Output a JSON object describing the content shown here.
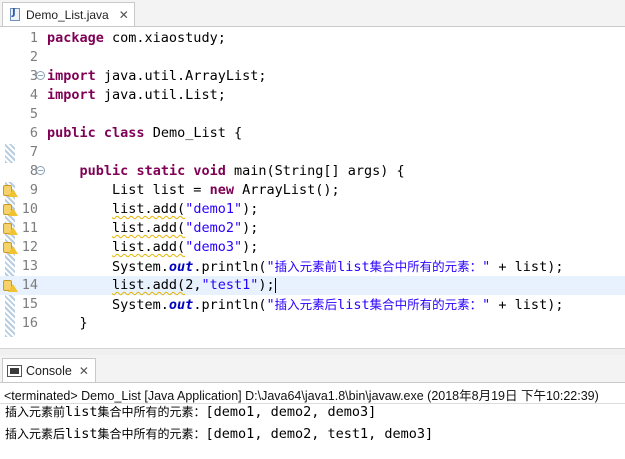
{
  "editor": {
    "tab": {
      "filename": "Demo_List.java",
      "close": "✕"
    },
    "lines": [
      {
        "n": "1",
        "tokens": [
          [
            "kw",
            "package"
          ],
          [
            "",
            "&nbsp;com.xiaostudy;"
          ]
        ]
      },
      {
        "n": "2",
        "tokens": []
      },
      {
        "n": "3",
        "fold": "−",
        "tokens": [
          [
            "kw",
            "import"
          ],
          [
            "",
            "&nbsp;java.util.ArrayList;"
          ]
        ]
      },
      {
        "n": "4",
        "tokens": [
          [
            "kw",
            "import"
          ],
          [
            "",
            "&nbsp;java.util.List;"
          ]
        ]
      },
      {
        "n": "5",
        "tokens": []
      },
      {
        "n": "6",
        "tokens": [
          [
            "kw",
            "public"
          ],
          [
            "",
            "&nbsp;"
          ],
          [
            "kw",
            "class"
          ],
          [
            "",
            "&nbsp;Demo_List {"
          ]
        ]
      },
      {
        "n": "7",
        "tokens": []
      },
      {
        "n": "8",
        "fold": "−",
        "tokens": [
          [
            "",
            "    "
          ],
          [
            "kw",
            "public"
          ],
          [
            "",
            "&nbsp;"
          ],
          [
            "kw",
            "static"
          ],
          [
            "",
            "&nbsp;"
          ],
          [
            "kw",
            "void"
          ],
          [
            "",
            "&nbsp;main(String[] args) {"
          ]
        ]
      },
      {
        "n": "9",
        "warn": true,
        "tokens": [
          [
            "",
            "        List list = "
          ],
          [
            "kw",
            "new"
          ],
          [
            "",
            "&nbsp;ArrayList();"
          ]
        ]
      },
      {
        "n": "10",
        "warn": true,
        "tokens": [
          [
            "",
            "        "
          ],
          [
            "warnul",
            "list.add("
          ],
          [
            "str",
            "\"demo1\""
          ],
          [
            "",
            ");"
          ]
        ]
      },
      {
        "n": "11",
        "warn": true,
        "tokens": [
          [
            "",
            "        "
          ],
          [
            "warnul",
            "list.add("
          ],
          [
            "str",
            "\"demo2\""
          ],
          [
            "",
            ");"
          ]
        ]
      },
      {
        "n": "12",
        "warn": true,
        "tokens": [
          [
            "",
            "        "
          ],
          [
            "warnul",
            "list.add("
          ],
          [
            "str",
            "\"demo3\""
          ],
          [
            "",
            ");"
          ]
        ]
      },
      {
        "n": "13",
        "tokens": [
          [
            "",
            "        System."
          ],
          [
            "fld",
            "out"
          ],
          [
            "",
            ".println("
          ],
          [
            "str",
            "\""
          ],
          [
            "strcjk",
            "插入元素前"
          ],
          [
            "str",
            "list"
          ],
          [
            "strcjk",
            "集合中所有的元素："
          ],
          [
            "str",
            "\""
          ],
          [
            "",
            " + list);"
          ]
        ]
      },
      {
        "n": "14",
        "warn": true,
        "current": true,
        "tokens": [
          [
            "",
            "        "
          ],
          [
            "warnul",
            "list.add("
          ],
          [
            "",
            "2,"
          ],
          [
            "str",
            "\"test1\""
          ],
          [
            "",
            ");"
          ],
          [
            "cursor",
            ""
          ]
        ]
      },
      {
        "n": "15",
        "tokens": [
          [
            "",
            "        System."
          ],
          [
            "fld",
            "out"
          ],
          [
            "",
            ".println("
          ],
          [
            "str",
            "\""
          ],
          [
            "strcjk",
            "插入元素后"
          ],
          [
            "str",
            "list"
          ],
          [
            "strcjk",
            "集合中所有的元素："
          ],
          [
            "str",
            "\""
          ],
          [
            "",
            " + list);"
          ]
        ]
      },
      {
        "n": "16",
        "tokens": [
          [
            "",
            "    }"
          ]
        ]
      }
    ]
  },
  "console": {
    "tab_label": "Console",
    "close": "✕",
    "status": "<terminated> Demo_List [Java Application] D:\\Java64\\java1.8\\bin\\javaw.exe (2018年8月19日 下午10:22:39)",
    "output": [
      {
        "cjk": "插入元素前",
        "rest": "list",
        "cjk2": "集合中所有的元素：",
        "value": "[demo1, demo2, demo3]"
      },
      {
        "cjk": "插入元素后",
        "rest": "list",
        "cjk2": "集合中所有的元素：",
        "value": "[demo1, demo2, test1, demo3]"
      }
    ]
  }
}
